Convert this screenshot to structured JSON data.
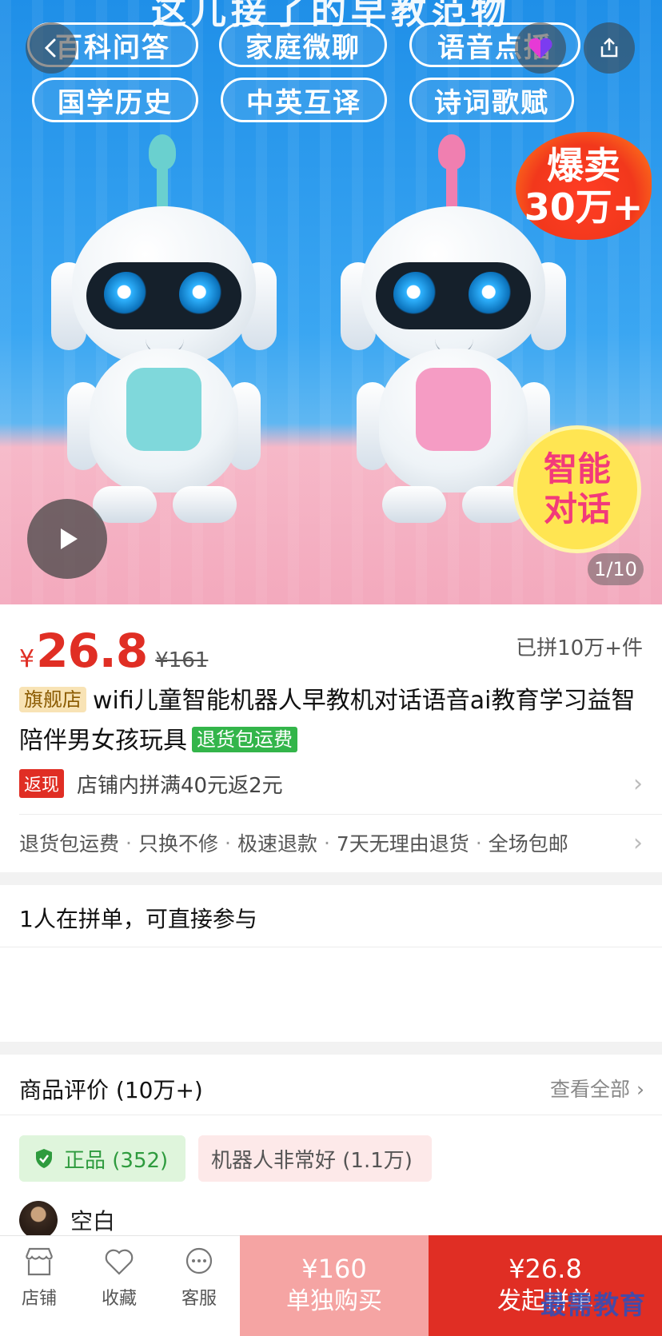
{
  "hero": {
    "top_banner": "这儿接了的早教范物",
    "pills": [
      "百科问答",
      "家庭微聊",
      "语音点播",
      "国学历史",
      "中英互译",
      "诗词歌赋"
    ],
    "hot_badge_line1": "爆卖",
    "hot_badge_line2": "30万+",
    "smart_badge_line1": "智能",
    "smart_badge_line2": "对话",
    "image_counter": "1/10",
    "colors": {
      "antenna_left": "#6ad0cf",
      "antenna_right": "#f07fb0",
      "panel_left": "#7fd8db",
      "panel_right": "#f59cc4"
    }
  },
  "nav": {
    "back_icon": "chevron-left-icon",
    "favorite_icon": "heart-app-icon",
    "share_icon": "share-icon"
  },
  "product": {
    "currency": "¥",
    "price": "26.8",
    "original_price": "¥161",
    "sold": "已拼10万+件",
    "flag": "旗舰店",
    "title": "wifi儿童智能机器人早教机对话语音ai教育学习益智陪伴男女孩玩具",
    "free_return_tag": "退货包运费",
    "promo_tag": "返现",
    "promo_text": "店铺内拼满40元返2元",
    "services": [
      "退货包运费",
      "只换不修",
      "极速退款",
      "7天无理由退货",
      "全场包邮"
    ]
  },
  "group": {
    "title": "1人在拼单，可直接参与"
  },
  "reviews": {
    "title": "商品评价 (10万+)",
    "view_all": "查看全部",
    "tags": [
      {
        "label": "正品 (352)",
        "icon": "shield-check-icon"
      },
      {
        "label": "机器人非常好 (1.1万)"
      }
    ],
    "first_user": "空白"
  },
  "bottom_bar": {
    "tabs": [
      {
        "label": "店铺",
        "icon": "store-icon"
      },
      {
        "label": "收藏",
        "icon": "heart-icon"
      },
      {
        "label": "客服",
        "icon": "chat-icon"
      }
    ],
    "buy_alone_price": "¥160",
    "buy_alone_label": "单独购买",
    "buy_group_price": "¥26.8",
    "buy_group_label": "发起拼单"
  },
  "watermark": "最需教育",
  "colors": {
    "brand_red": "#e02e24",
    "light_red": "#f5a4a3",
    "green": "#33b54a"
  }
}
